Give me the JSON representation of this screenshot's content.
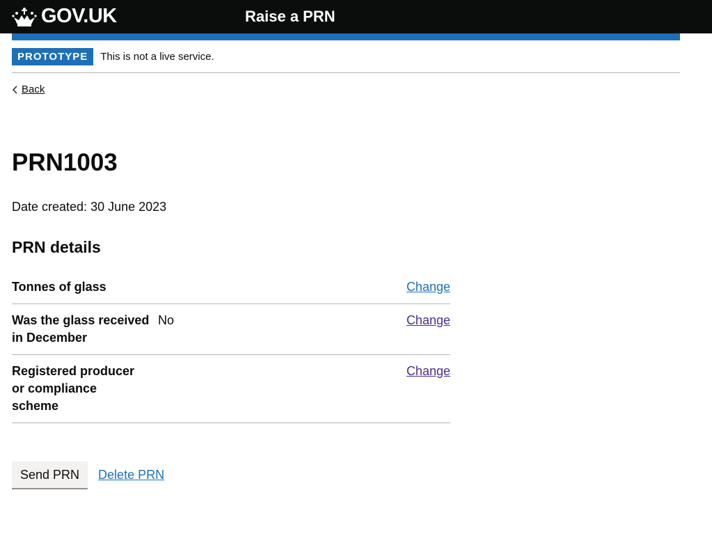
{
  "header": {
    "logo": "GOV.UK",
    "service": "Raise a PRN"
  },
  "phase": {
    "tag": "PROTOTYPE",
    "text": "This is not a live service."
  },
  "back": "Back",
  "title": "PRN1003",
  "date_created": "Date created: 30 June 2023",
  "section_title": "PRN details",
  "rows": [
    {
      "key": "Tonnes of glass",
      "value": "",
      "action": "Change"
    },
    {
      "key": "Was the glass received in December",
      "value": "No",
      "action": "Change"
    },
    {
      "key": "Registered producer or compliance scheme",
      "value": "",
      "action": "Change"
    }
  ],
  "buttons": {
    "send": "Send PRN",
    "delete": "Delete PRN"
  },
  "colors": {
    "brand": "#1d70b8",
    "link": "#1d70b8",
    "visited": "#4c2c92",
    "header": "#0b0c0c"
  }
}
